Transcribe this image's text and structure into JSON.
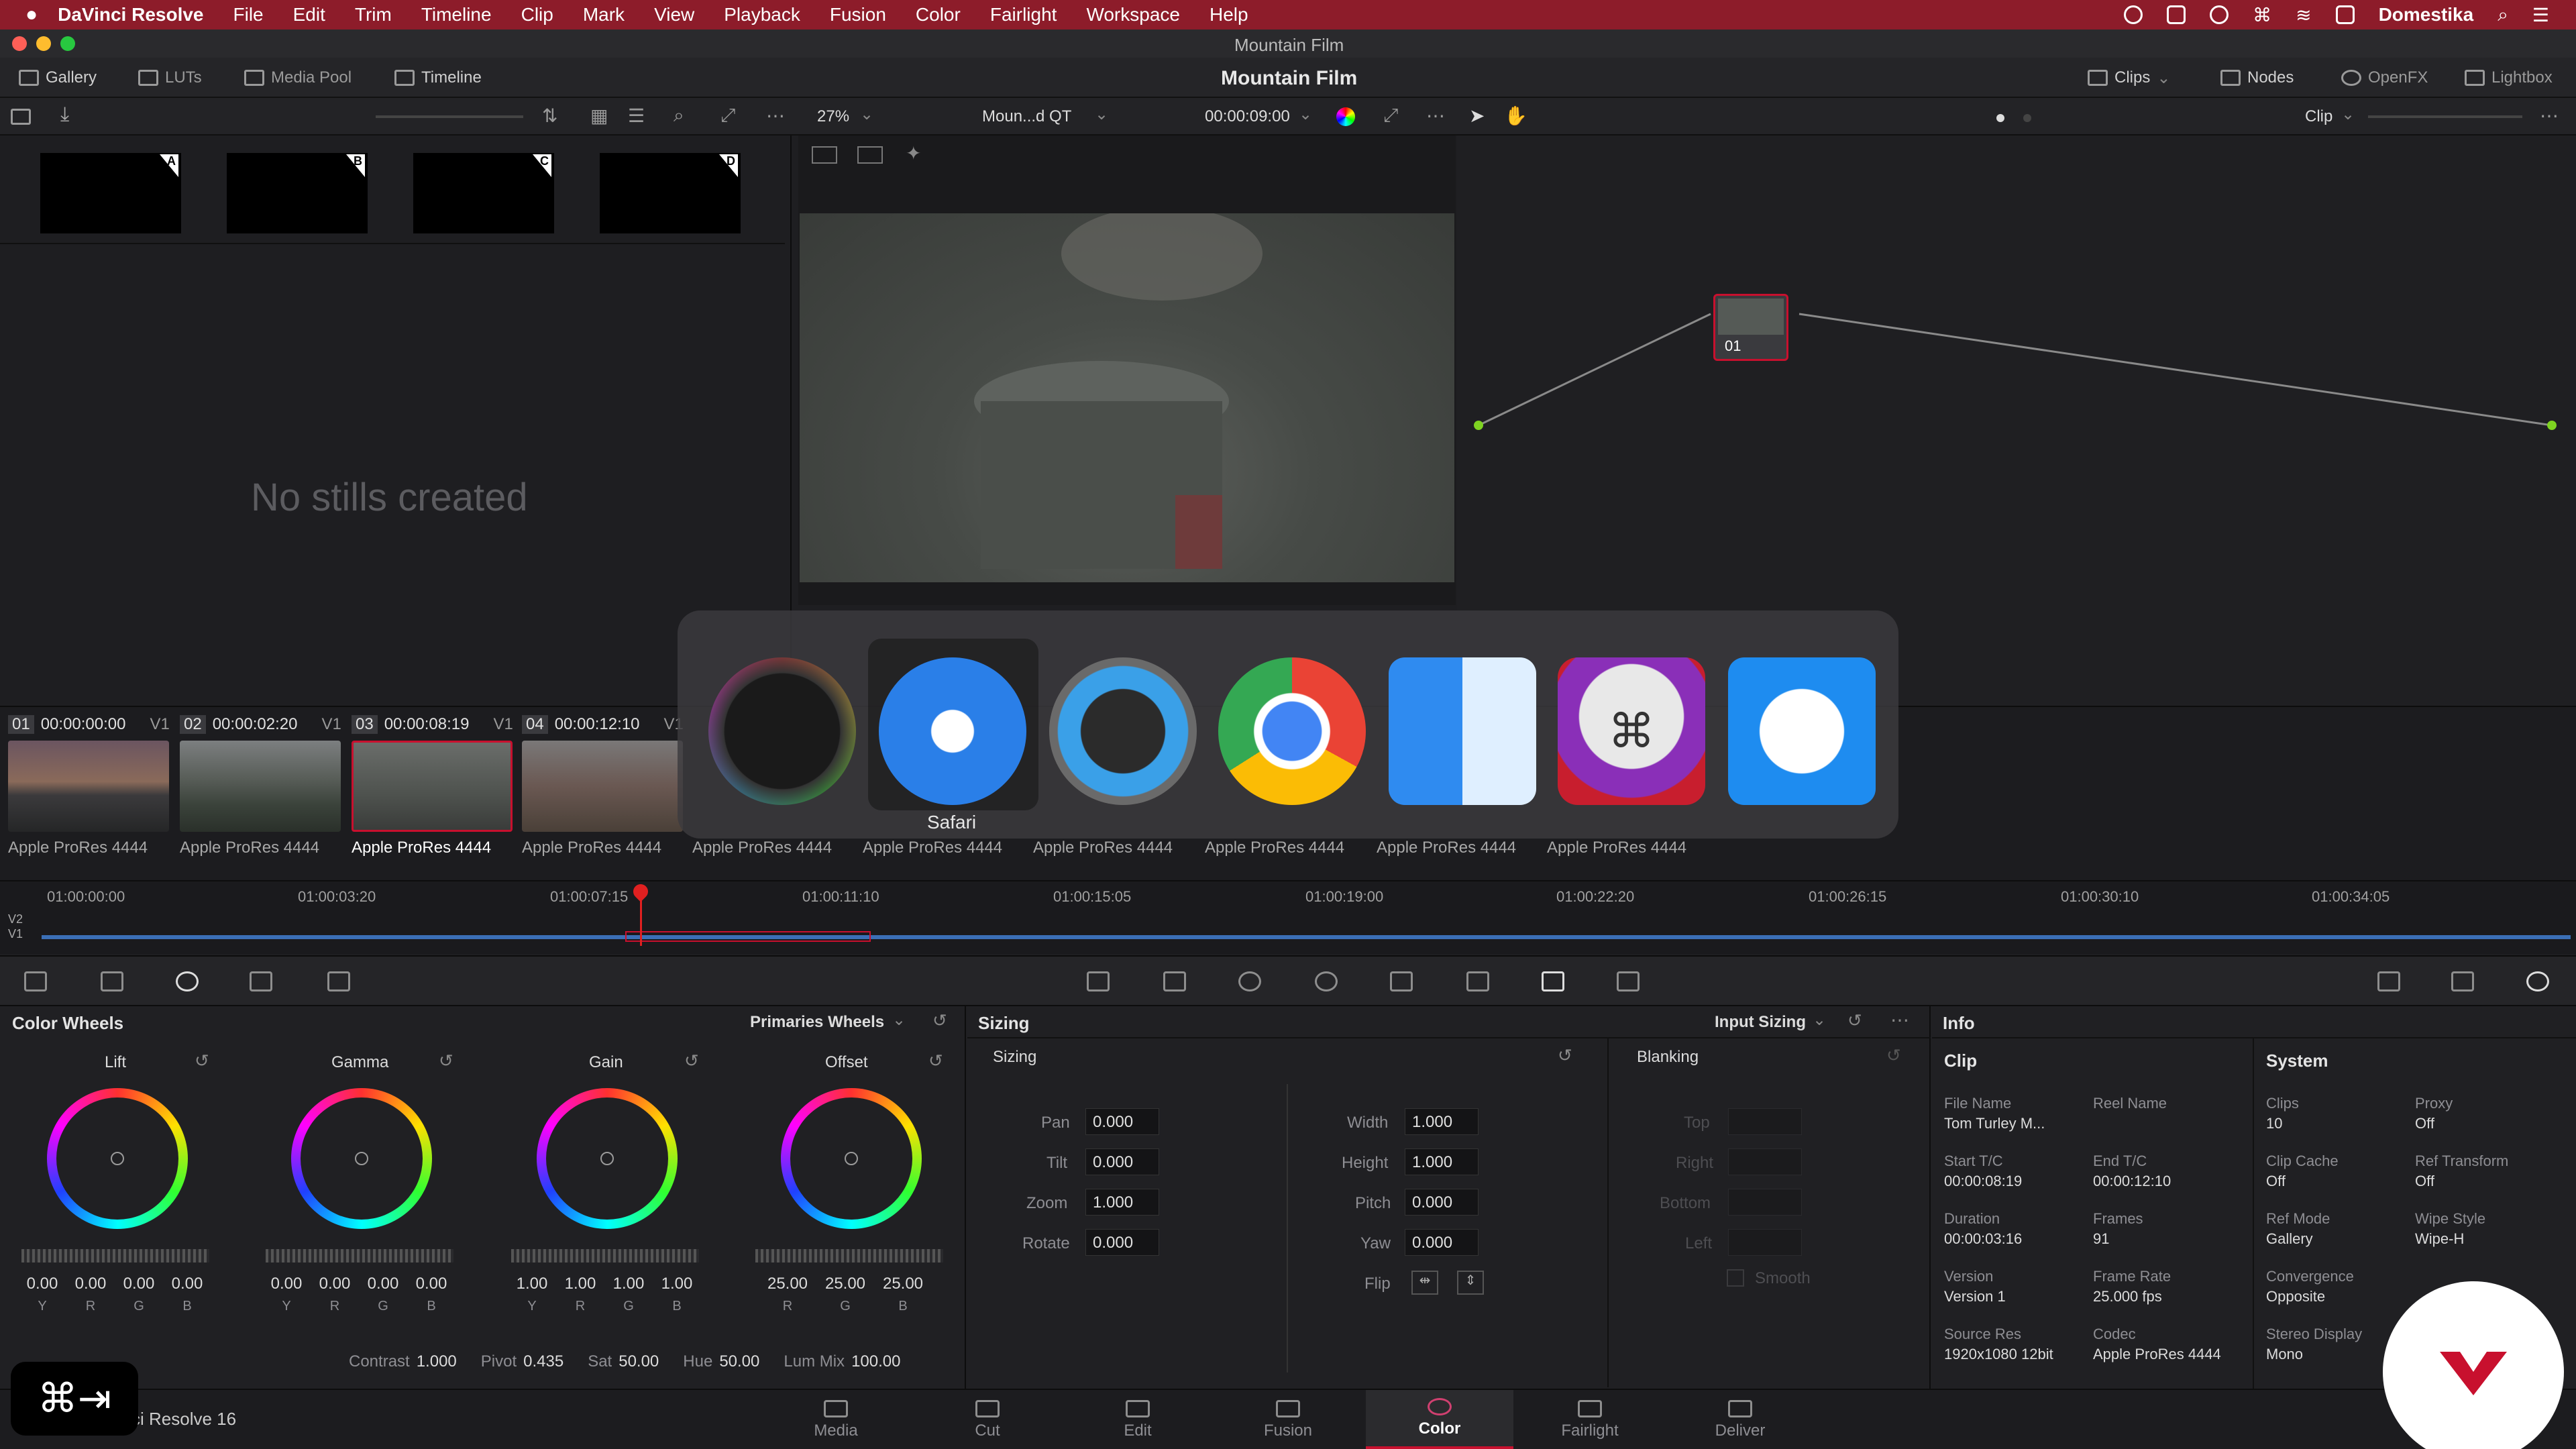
{
  "menubar": {
    "items": [
      "DaVinci Resolve",
      "File",
      "Edit",
      "Trim",
      "Timeline",
      "Clip",
      "Mark",
      "View",
      "Playback",
      "Fusion",
      "Color",
      "Fairlight",
      "Workspace",
      "Help"
    ],
    "user": "Domestika"
  },
  "window": {
    "title": "Mountain Film"
  },
  "toolbar": {
    "left": [
      "Gallery",
      "LUTs",
      "Media Pool",
      "Timeline"
    ],
    "project_title": "Mountain Film",
    "right": [
      "Clips",
      "Nodes",
      "OpenFX",
      "Lightbox"
    ]
  },
  "viewer_bar": {
    "zoom": "27%",
    "clip_name": "Moun...d QT",
    "timecode": "00:00:09:00",
    "mode": "Clip"
  },
  "gallery": {
    "empty_text": "No stills created",
    "stills": [
      "A",
      "B",
      "C",
      "D"
    ]
  },
  "node": {
    "label": "01"
  },
  "clips": [
    {
      "num": "01",
      "tc": "00:00:00:00",
      "track": "V1",
      "codec": "Apple ProRes 4444"
    },
    {
      "num": "02",
      "tc": "00:00:02:20",
      "track": "V1",
      "codec": "Apple ProRes 4444"
    },
    {
      "num": "03",
      "tc": "00:00:08:19",
      "track": "V1",
      "codec": "Apple ProRes 4444"
    },
    {
      "num": "04",
      "tc": "00:00:12:10",
      "track": "V1",
      "codec": "Apple ProRes 4444"
    }
  ],
  "clip_captions_extra": [
    "Apple ProRes 4444",
    "Apple ProRes 4444",
    "Apple ProRes 4444",
    "Apple ProRes 4444",
    "Apple ProRes 4444",
    "Apple ProRes 4444"
  ],
  "mini_timeline": {
    "ticks": [
      "01:00:00:00",
      "01:00:03:20",
      "01:00:07:15",
      "01:00:11:10",
      "01:00:15:05",
      "01:00:19:00",
      "01:00:22:20",
      "01:00:26:15",
      "01:00:30:10",
      "01:00:34:05"
    ],
    "tracks": [
      "V2",
      "V1"
    ]
  },
  "color_wheels": {
    "title": "Color Wheels",
    "mode": "Primaries Wheels",
    "wheels": [
      {
        "name": "Lift",
        "values": [
          "0.00",
          "0.00",
          "0.00",
          "0.00"
        ],
        "channels": [
          "Y",
          "R",
          "G",
          "B"
        ]
      },
      {
        "name": "Gamma",
        "values": [
          "0.00",
          "0.00",
          "0.00",
          "0.00"
        ],
        "channels": [
          "Y",
          "R",
          "G",
          "B"
        ]
      },
      {
        "name": "Gain",
        "values": [
          "1.00",
          "1.00",
          "1.00",
          "1.00"
        ],
        "channels": [
          "Y",
          "R",
          "G",
          "B"
        ]
      },
      {
        "name": "Offset",
        "values": [
          "25.00",
          "25.00",
          "25.00"
        ],
        "channels": [
          "R",
          "G",
          "B"
        ]
      }
    ],
    "bottom": {
      "contrast_label": "Contrast",
      "contrast": "1.000",
      "pivot_label": "Pivot",
      "pivot": "0.435",
      "sat_label": "Sat",
      "sat": "50.00",
      "hue_label": "Hue",
      "hue": "50.00",
      "lummix_label": "Lum Mix",
      "lummix": "100.00"
    }
  },
  "sizing": {
    "title": "Sizing",
    "mode": "Input Sizing",
    "section": "Sizing",
    "blanking": "Blanking",
    "left": [
      {
        "label": "Pan",
        "value": "0.000"
      },
      {
        "label": "Tilt",
        "value": "0.000"
      },
      {
        "label": "Zoom",
        "value": "1.000"
      },
      {
        "label": "Rotate",
        "value": "0.000"
      }
    ],
    "right": [
      {
        "label": "Width",
        "value": "1.000"
      },
      {
        "label": "Height",
        "value": "1.000"
      },
      {
        "label": "Pitch",
        "value": "0.000"
      },
      {
        "label": "Yaw",
        "value": "0.000"
      }
    ],
    "flip_label": "Flip",
    "blank_fields": [
      "Top",
      "Right",
      "Bottom",
      "Left"
    ],
    "smooth": "Smooth"
  },
  "info": {
    "title": "Info",
    "clip_header": "Clip",
    "system_header": "System",
    "clip": [
      {
        "label": "File Name",
        "value": "Tom Turley M..."
      },
      {
        "label": "Reel Name",
        "value": ""
      },
      {
        "label": "Start T/C",
        "value": "00:00:08:19"
      },
      {
        "label": "End T/C",
        "value": "00:00:12:10"
      },
      {
        "label": "Duration",
        "value": "00:00:03:16"
      },
      {
        "label": "Frames",
        "value": "91"
      },
      {
        "label": "Version",
        "value": "Version 1"
      },
      {
        "label": "Frame Rate",
        "value": "25.000 fps"
      },
      {
        "label": "Source Res",
        "value": "1920x1080 12bit"
      },
      {
        "label": "Codec",
        "value": "Apple ProRes 4444"
      }
    ],
    "system": [
      {
        "label": "Clips",
        "value": "10"
      },
      {
        "label": "Proxy",
        "value": "Off"
      },
      {
        "label": "Clip Cache",
        "value": "Off"
      },
      {
        "label": "Ref Transform",
        "value": "Off"
      },
      {
        "label": "Ref Mode",
        "value": "Gallery"
      },
      {
        "label": "Wipe Style",
        "value": "Wipe-H"
      },
      {
        "label": "Convergence",
        "value": "Opposite"
      },
      {
        "label": "Stereo Display",
        "value": "Mono"
      }
    ]
  },
  "pages": [
    "Media",
    "Cut",
    "Edit",
    "Fusion",
    "Color",
    "Fairlight",
    "Deliver"
  ],
  "active_page": "Color",
  "app_footer": "ci Resolve 16",
  "switcher": {
    "selected_label": "Safari",
    "apps": [
      "davinci-resolve",
      "safari",
      "quicktime",
      "chrome",
      "finder",
      "keycastr",
      "teamviewer"
    ]
  },
  "keystroke": "⌘⇥"
}
